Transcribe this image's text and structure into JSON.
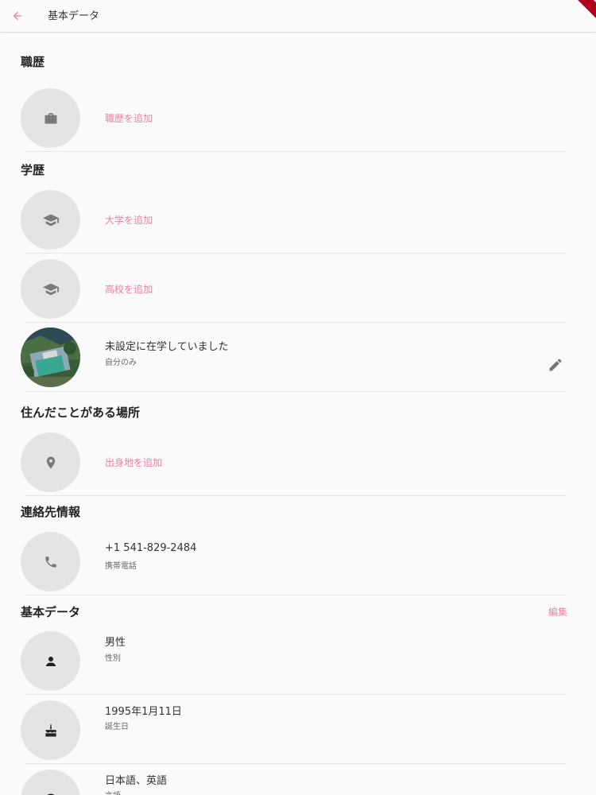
{
  "appbar": {
    "title": "基本データ",
    "back_icon": "arrow-back-icon",
    "accent": "#ee7fa6"
  },
  "sections": {
    "work": {
      "title": "職歴",
      "add_label": "職歴を追加",
      "icon": "briefcase-icon"
    },
    "education": {
      "title": "学歴",
      "add_university": "大学を追加",
      "add_highschool": "高校を追加",
      "icon": "graduation-cap-icon",
      "entry": {
        "main": "未設定に在学していました",
        "sub": "自分のみ"
      }
    },
    "places": {
      "title": "住んだことがある場所",
      "add_label": "出身地を追加",
      "icon": "location-pin-icon"
    },
    "contact": {
      "title": "連絡先情報",
      "phone": "+1 541-829-2484",
      "phone_label": "携帯電話",
      "icon": "phone-icon"
    },
    "basic": {
      "title": "基本データ",
      "edit_label": "編集",
      "gender": "男性",
      "gender_label": "性別",
      "birthday": "1995年1月11日",
      "birthday_label": "誕生日",
      "languages": "日本語、英語",
      "languages_label": "言語"
    }
  }
}
